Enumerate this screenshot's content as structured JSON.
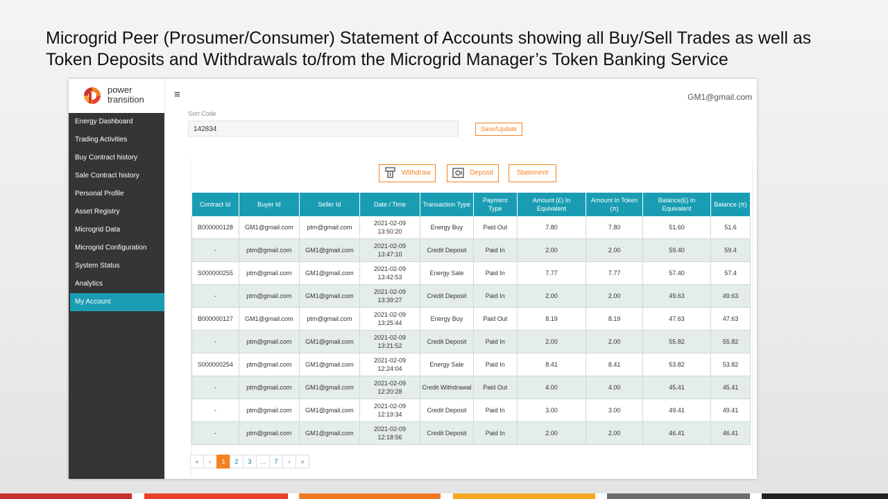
{
  "slide": {
    "title": "Microgrid Peer (Prosumer/Consumer) Statement of Accounts showing all Buy/Sell Trades as well as Token Deposits and Withdrawals to/from the Microgrid Manager’s Token Banking Service"
  },
  "brand": {
    "name_line1": "power",
    "name_line2": "transition",
    "logo_icon": "power-transition-logo",
    "colors": {
      "accent": "#f58220",
      "teal": "#1a9db3",
      "sidebar": "#353535"
    }
  },
  "header": {
    "menu_icon": "≡",
    "user_email": "GM1@gmail.com"
  },
  "sidebar": {
    "items": [
      {
        "label": "Energy Dashboard"
      },
      {
        "label": "Trading Activities"
      },
      {
        "label": "Buy Contract history"
      },
      {
        "label": "Sale Contract history"
      },
      {
        "label": "Personal Profile"
      },
      {
        "label": "Asset Registry"
      },
      {
        "label": "Microgrid Data"
      },
      {
        "label": "Microgrid Configuration"
      },
      {
        "label": "System Status"
      },
      {
        "label": "Analytics"
      },
      {
        "label": "My Account",
        "active": true
      }
    ]
  },
  "account": {
    "sort_code_label": "Sort Code",
    "sort_code_value": "142834",
    "save_label": "Save/Update"
  },
  "actions": {
    "withdraw_label": "Withdraw",
    "deposit_label": "Deposit",
    "statement_label": "Statement"
  },
  "table": {
    "headers": [
      "Contract Id",
      "Buyer Id",
      "Seller Id",
      "Date / Time",
      "Transaction Type",
      "Payment Type",
      "Amount (£) In Equivalent",
      "Amount In Token (π)",
      "Balance(£) In Equivalent",
      "Balance (π)"
    ],
    "rows": [
      [
        "B000000128",
        "GM1@gmail.com",
        "ptm@gmail.com",
        "2021-02-09 13:50:20",
        "Energy Buy",
        "Paid Out",
        "7.80",
        "7.80",
        "51.60",
        "51.6"
      ],
      [
        "-",
        "ptm@gmail.com",
        "GM1@gmail.com",
        "2021-02-09 13:47:10",
        "Credit Deposit",
        "Paid In",
        "2.00",
        "2.00",
        "59.40",
        "59.4"
      ],
      [
        "S000000255",
        "ptm@gmail.com",
        "GM1@gmail.com",
        "2021-02-09 13:42:53",
        "Energy Sale",
        "Paid In",
        "7.77",
        "7.77",
        "57.40",
        "57.4"
      ],
      [
        "-",
        "ptm@gmail.com",
        "GM1@gmail.com",
        "2021-02-09 13:39:27",
        "Credit Deposit",
        "Paid In",
        "2.00",
        "2.00",
        "49.63",
        "49.63"
      ],
      [
        "B000000127",
        "GM1@gmail.com",
        "ptm@gmail.com",
        "2021-02-09 13:25:44",
        "Energy Buy",
        "Paid Out",
        "8.19",
        "8.19",
        "47.63",
        "47.63"
      ],
      [
        "-",
        "ptm@gmail.com",
        "GM1@gmail.com",
        "2021-02-09 13:21:52",
        "Credit Deposit",
        "Paid In",
        "2.00",
        "2.00",
        "55.82",
        "55.82"
      ],
      [
        "S000000254",
        "ptm@gmail.com",
        "GM1@gmail.com",
        "2021-02-09 12:24:04",
        "Energy Sale",
        "Paid In",
        "8.41",
        "8.41",
        "53.82",
        "53.82"
      ],
      [
        "-",
        "ptm@gmail.com",
        "GM1@gmail.com",
        "2021-02-09 12:20:28",
        "Credit Withdrawal",
        "Paid Out",
        "4.00",
        "4.00",
        "45.41",
        "45.41"
      ],
      [
        "-",
        "ptm@gmail.com",
        "GM1@gmail.com",
        "2021-02-09 12:19:34",
        "Credit Deposit",
        "Paid In",
        "3.00",
        "3.00",
        "49.41",
        "49.41"
      ],
      [
        "-",
        "ptm@gmail.com",
        "GM1@gmail.com",
        "2021-02-09 12:18:56",
        "Credit Deposit",
        "Paid In",
        "2.00",
        "2.00",
        "46.41",
        "46.41"
      ]
    ]
  },
  "pagination": {
    "items": [
      "«",
      "‹",
      "1",
      "2",
      "3",
      "…",
      "7",
      "›",
      "»"
    ],
    "active": "1"
  }
}
